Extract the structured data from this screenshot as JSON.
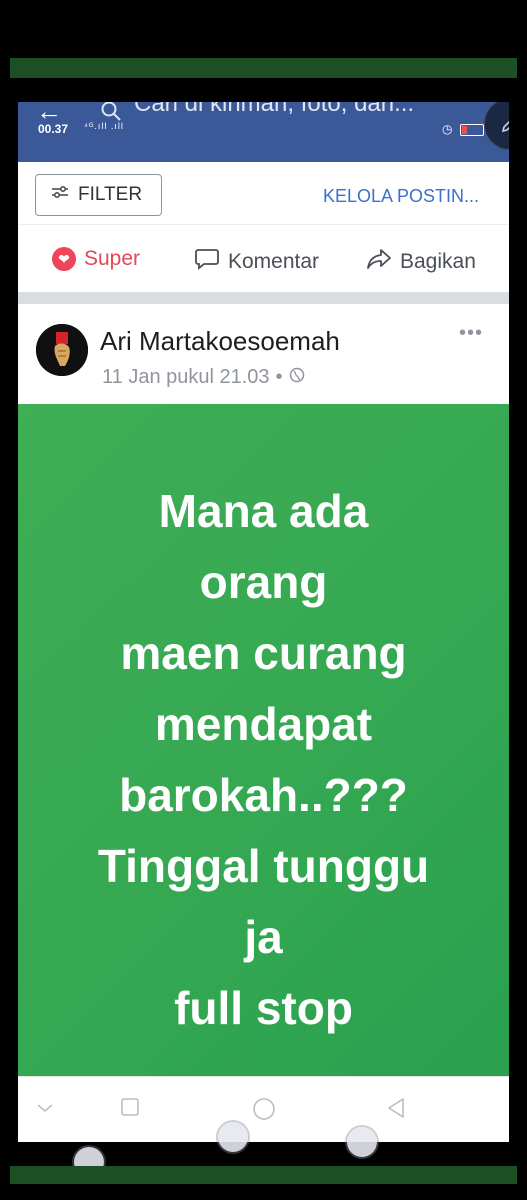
{
  "search": {
    "placeholder": "Cari di kiriman, foto, dan..."
  },
  "status": {
    "time": "00.37",
    "signal": "⁴ᴳ.ıll .ıll"
  },
  "toolbar": {
    "filter_label": "FILTER",
    "manage_label": "KELOLA POSTIN..."
  },
  "reactions": {
    "super": "Super",
    "comment": "Komentar",
    "share": "Bagikan"
  },
  "post": {
    "author": "Ari Martakoesoemah",
    "timestamp": "11 Jan pukul 21.03",
    "lines": [
      "Mana ada",
      "orang",
      "maen curang",
      "mendapat",
      "barokah..???",
      "Tinggal tunggu",
      "ja",
      "full stop"
    ]
  },
  "colors": {
    "header": "#3b5998",
    "post_background": "#35a852",
    "accent_blue": "#3b6fd0",
    "super_red": "#e3485a",
    "band_green": "#1c4f24"
  },
  "icons": {
    "back": "arrow-left",
    "search": "magnifier",
    "filter": "sliders",
    "super": "heart",
    "comment": "speech-bubble",
    "share": "share-arrow",
    "privacy": "globe",
    "more": "ellipsis"
  }
}
